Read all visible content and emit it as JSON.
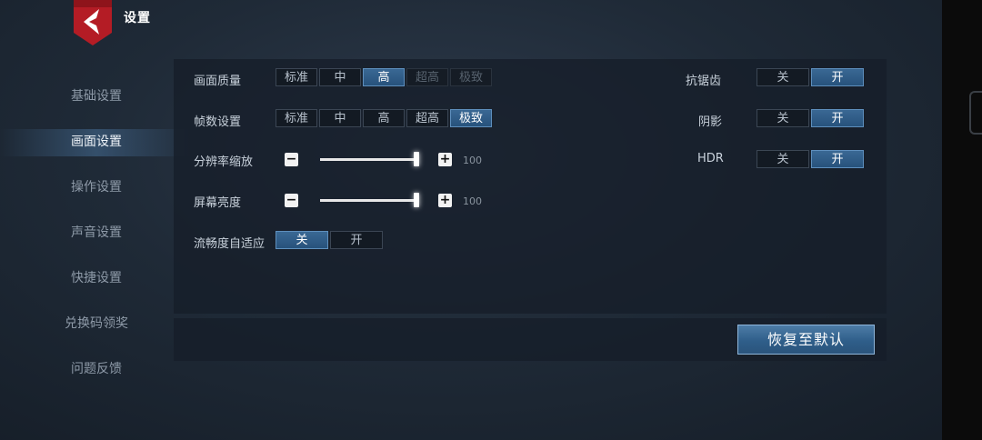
{
  "header": {
    "title": "设置"
  },
  "sidebar": {
    "items": [
      {
        "label": "基础设置"
      },
      {
        "label": "画面设置"
      },
      {
        "label": "操作设置"
      },
      {
        "label": "声音设置"
      },
      {
        "label": "快捷设置"
      },
      {
        "label": "兑换码领奖"
      },
      {
        "label": "问题反馈"
      }
    ],
    "active_index": 1
  },
  "settings": {
    "quality": {
      "label": "画面质量",
      "options": [
        "标准",
        "中",
        "高",
        "超高",
        "极致"
      ],
      "selected": "高",
      "disabled": [
        "超高",
        "极致"
      ]
    },
    "framerate": {
      "label": "帧数设置",
      "options": [
        "标准",
        "中",
        "高",
        "超高",
        "极致"
      ],
      "selected": "极致"
    },
    "resolution": {
      "label": "分辨率缩放",
      "minus": "−",
      "plus": "+",
      "value": "100",
      "level": 1.0
    },
    "brightness": {
      "label": "屏幕亮度",
      "minus": "−",
      "plus": "+",
      "value": "100",
      "level": 1.0
    },
    "smooth": {
      "label": "流畅度自适应",
      "off": "关",
      "on": "开",
      "selected": "关"
    },
    "antialias": {
      "label": "抗锯齿",
      "off": "关",
      "on": "开",
      "selected": "开"
    },
    "shadow": {
      "label": "阴影",
      "off": "关",
      "on": "开",
      "selected": "开"
    },
    "hdr": {
      "label": "HDR",
      "off": "关",
      "on": "开",
      "selected": "开"
    }
  },
  "footer": {
    "reset_label": "恢复至默认"
  },
  "colors": {
    "accent": "#2f5e8a",
    "selected": "#3a6894",
    "logo_red": "#c8202a"
  }
}
